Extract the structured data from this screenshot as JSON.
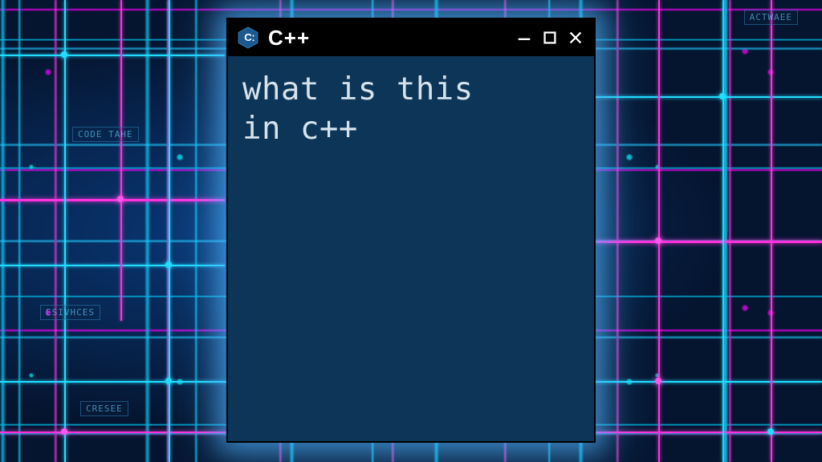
{
  "window": {
    "title": "C++",
    "icon": "cpp-hex-icon"
  },
  "content": {
    "line1": "what is this",
    "line2": "in c++"
  },
  "colors": {
    "window_bg": "#0d3558",
    "titlebar_bg": "#000000",
    "text": "#d7e3ec",
    "glow": "#50b4ff",
    "circuit_cyan": "#22ddff",
    "circuit_pink": "#ff33dd"
  },
  "bg_chips": {
    "top_right": "ACTWAEE",
    "left_1": "CODE TAHE",
    "left_2": "ESIVHCES",
    "bottom_left": "CRESEE"
  }
}
